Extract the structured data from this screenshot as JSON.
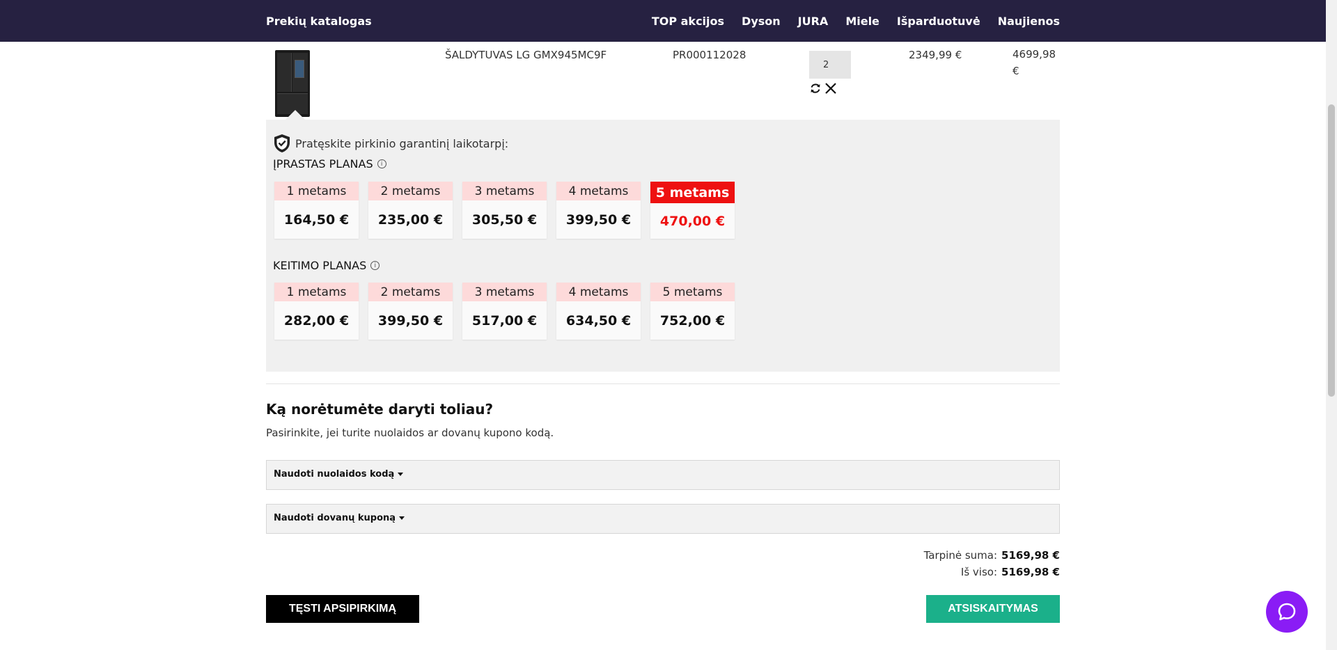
{
  "header": {
    "brand": "Prekių katalogas",
    "nav": [
      "TOP akcijos",
      "Dyson",
      "JURA",
      "Miele",
      "Išparduotuvė",
      "Naujienos"
    ]
  },
  "cart_item": {
    "name": "ŠALDYTUVAS LG GMX945MC9F",
    "code": "PR000112028",
    "quantity": "2",
    "unit_price": "2349,99 €",
    "line_total": "4699,98 €",
    "image_icon": "refrigerator-image",
    "refresh_icon": "refresh-icon",
    "remove_icon": "close-icon"
  },
  "warranty": {
    "heading": "Pratęskite pirkinio garantinį laikotarpį:",
    "standard_plan": {
      "title": "ĮPRASTAS PLANAS",
      "options": [
        {
          "years": "1 metams",
          "price": "164,50 €"
        },
        {
          "years": "2 metams",
          "price": "235,00 €"
        },
        {
          "years": "3 metams",
          "price": "305,50 €"
        },
        {
          "years": "4 metams",
          "price": "399,50 €"
        },
        {
          "years": "5 metams",
          "price": "470,00 €",
          "selected": true
        }
      ]
    },
    "replacement_plan": {
      "title": "KEITIMO PLANAS",
      "options": [
        {
          "years": "1 metams",
          "price": "282,00 €"
        },
        {
          "years": "2 metams",
          "price": "399,50 €"
        },
        {
          "years": "3 metams",
          "price": "517,00 €"
        },
        {
          "years": "4 metams",
          "price": "634,50 €"
        },
        {
          "years": "5 metams",
          "price": "752,00 €"
        }
      ]
    }
  },
  "next": {
    "title": "Ką norėtumėte daryti toliau?",
    "subtitle": "Pasirinkite, jei turite nuolaidos ar dovanų kupono kodą."
  },
  "coupons": {
    "discount_label": "Naudoti nuolaidos kodą",
    "gift_label": "Naudoti dovanų kuponą"
  },
  "totals": {
    "subtotal_label": "Tarpinė suma:",
    "subtotal_value": "5169,98 €",
    "total_label": "Iš viso:",
    "total_value": "5169,98 €"
  },
  "actions": {
    "continue_label": "TĘSTI APSIPIRKIMĄ",
    "checkout_label": "ATSISKAITYMAS"
  },
  "colors": {
    "header_bg": "#262141",
    "accent_red": "#ee1111",
    "checkout_green": "#1bb08a",
    "chat_purple": "#8a1cf5"
  }
}
